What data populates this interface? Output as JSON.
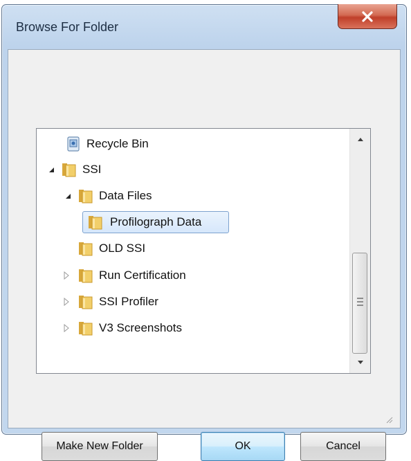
{
  "window": {
    "title": "Browse For Folder",
    "close_label": "X"
  },
  "tree": {
    "items": [
      {
        "label": "Recycle Bin",
        "icon": "recycle-bin-icon",
        "expander": "none"
      },
      {
        "label": "SSI",
        "icon": "folder-icon",
        "expander": "expanded"
      },
      {
        "label": "Data Files",
        "icon": "folder-icon",
        "expander": "expanded"
      },
      {
        "label": "Profilograph Data",
        "icon": "folder-icon",
        "expander": "none",
        "selected": true
      },
      {
        "label": "OLD SSI",
        "icon": "folder-icon",
        "expander": "none"
      },
      {
        "label": "Run Certification",
        "icon": "folder-icon",
        "expander": "collapsed"
      },
      {
        "label": "SSI Profiler",
        "icon": "folder-icon",
        "expander": "collapsed"
      },
      {
        "label": "V3 Screenshots",
        "icon": "folder-icon",
        "expander": "collapsed"
      }
    ]
  },
  "buttons": {
    "make_new_folder": "Make New Folder",
    "ok": "OK",
    "cancel": "Cancel"
  },
  "colors": {
    "frame": "#c2d7ee",
    "close": "#c0402a",
    "selection": "#d6e7fb",
    "folder": "#e8c05a"
  }
}
